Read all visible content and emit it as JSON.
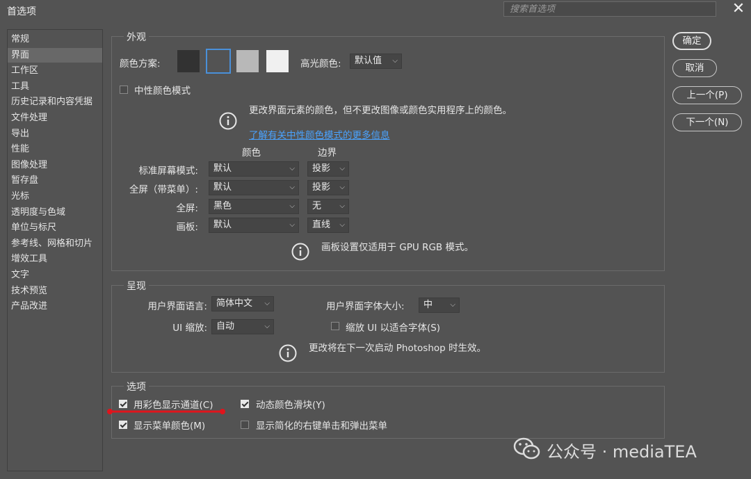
{
  "window": {
    "title": "首选项",
    "search_placeholder": "搜索首选项",
    "close_icon": "close-icon"
  },
  "sidebar": {
    "items": [
      {
        "label": "常规"
      },
      {
        "label": "界面",
        "selected": true
      },
      {
        "label": "工作区"
      },
      {
        "label": "工具"
      },
      {
        "label": "历史记录和内容凭据"
      },
      {
        "label": "文件处理"
      },
      {
        "label": "导出"
      },
      {
        "label": "性能"
      },
      {
        "label": "图像处理"
      },
      {
        "label": "暂存盘"
      },
      {
        "label": "光标"
      },
      {
        "label": "透明度与色域"
      },
      {
        "label": "单位与标尺"
      },
      {
        "label": "参考线、网格和切片"
      },
      {
        "label": "增效工具"
      },
      {
        "label": "文字"
      },
      {
        "label": "技术预览"
      },
      {
        "label": "产品改进"
      }
    ]
  },
  "appearance": {
    "title": "外观",
    "color_scheme_label": "颜色方案:",
    "swatches": [
      "#323232",
      "#535353",
      "#b8b8b8",
      "#f0f0f0"
    ],
    "selected_swatch_border": "#4a90d9",
    "highlight_label": "高光颜色:",
    "highlight_value": "默认值",
    "neutral_mode_label": "中性颜色模式",
    "neutral_mode_checked": false,
    "info_text": "更改界面元素的颜色，但不更改图像或颜色实用程序上的颜色。",
    "info_link": "了解有关中性颜色模式的更多信息",
    "col_color": "颜色",
    "col_border": "边界",
    "rows": [
      {
        "label": "标准屏幕模式:",
        "color": "默认",
        "border": "投影"
      },
      {
        "label": "全屏（带菜单）:",
        "color": "默认",
        "border": "投影"
      },
      {
        "label": "全屏:",
        "color": "黑色",
        "border": "无"
      },
      {
        "label": "画板:",
        "color": "默认",
        "border": "直线"
      }
    ],
    "artboard_note": "画板设置仅适用于 GPU RGB 模式。"
  },
  "presentation": {
    "title": "呈现",
    "ui_language_label": "用户界面语言:",
    "ui_language_value": "简体中文",
    "ui_font_size_label": "用户界面字体大小:",
    "ui_font_size_value": "中",
    "ui_scale_label": "UI 缩放:",
    "ui_scale_value": "自动",
    "scale_to_font_label": "缩放 UI 以适合字体(S)",
    "scale_to_font_checked": false,
    "restart_note": "更改将在下一次启动 Photoshop 时生效。"
  },
  "options": {
    "title": "选项",
    "items": [
      {
        "label": "用彩色显示通道(C)",
        "checked": true
      },
      {
        "label": "动态颜色滑块(Y)",
        "checked": true
      },
      {
        "label": "显示菜单颜色(M)",
        "checked": true
      },
      {
        "label": "显示简化的右键单击和弹出菜单",
        "checked": false
      }
    ],
    "annotation_color": "#e0141c"
  },
  "buttons": {
    "ok": "确定",
    "cancel": "取消",
    "prev": "上一个(P)",
    "next": "下一个(N)"
  },
  "watermark": {
    "text": "公众号 · mediaTEA",
    "icon": "wechat-icon"
  }
}
